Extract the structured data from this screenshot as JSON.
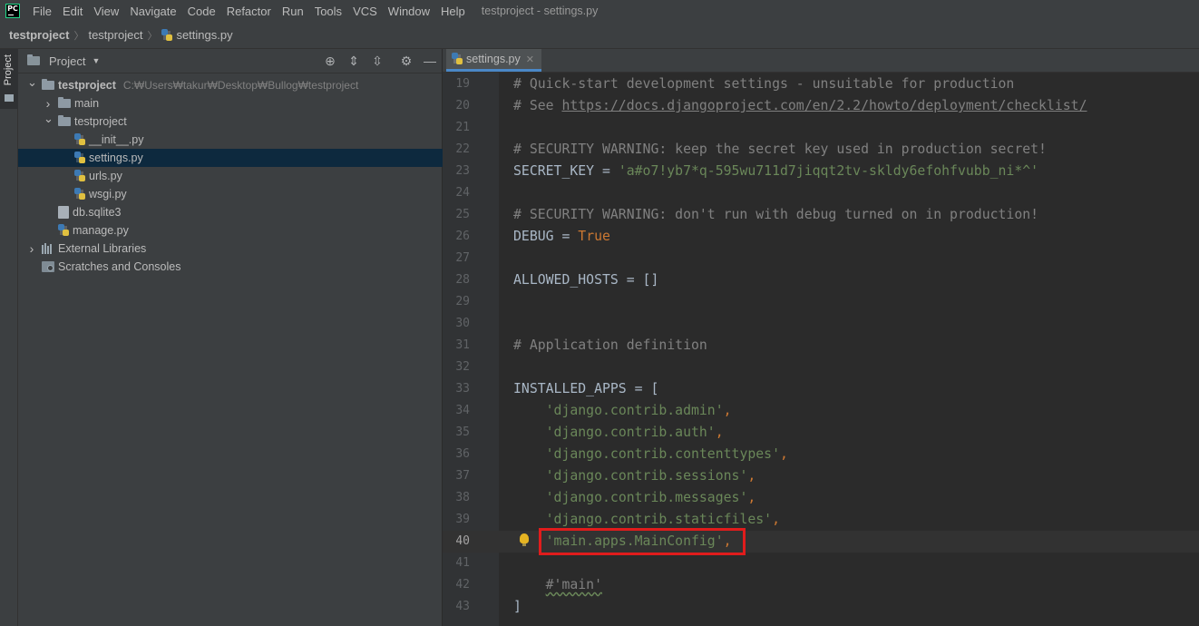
{
  "menubar": {
    "logo": "PC",
    "items": [
      "File",
      "Edit",
      "View",
      "Navigate",
      "Code",
      "Refactor",
      "Run",
      "Tools",
      "VCS",
      "Window",
      "Help"
    ],
    "window_title": "testproject - settings.py"
  },
  "breadcrumbs": [
    "testproject",
    "testproject",
    "settings.py"
  ],
  "left_strip": {
    "tab_label": "Project"
  },
  "project_panel": {
    "title": "Project",
    "tree": [
      {
        "label": "testproject",
        "hint": "C:₩Users₩takur₩Desktop₩Bullog₩testproject",
        "type": "folder",
        "expanded": true
      },
      {
        "label": "main",
        "type": "folder",
        "expanded": false
      },
      {
        "label": "testproject",
        "type": "folder",
        "expanded": true
      },
      {
        "label": "__init__.py",
        "type": "py"
      },
      {
        "label": "settings.py",
        "type": "py",
        "selected": true
      },
      {
        "label": "urls.py",
        "type": "py"
      },
      {
        "label": "wsgi.py",
        "type": "py"
      },
      {
        "label": "db.sqlite3",
        "type": "db"
      },
      {
        "label": "manage.py",
        "type": "py"
      },
      {
        "label": "External Libraries",
        "type": "lib",
        "expanded": false
      },
      {
        "label": "Scratches and Consoles",
        "type": "scratch"
      }
    ]
  },
  "editor": {
    "tab_label": "settings.py",
    "current_line": 40,
    "lines": [
      {
        "n": "19",
        "segs": [
          {
            "t": "# Quick-start development settings - unsuitable for production",
            "c": "comment"
          }
        ]
      },
      {
        "n": "20",
        "segs": [
          {
            "t": "# See ",
            "c": "comment"
          },
          {
            "t": "https://docs.djangoproject.com/en/2.2/howto/deployment/checklist/",
            "c": "link"
          }
        ]
      },
      {
        "n": "21",
        "segs": []
      },
      {
        "n": "22",
        "segs": [
          {
            "t": "# SECURITY WARNING: keep the secret key used in production secret!",
            "c": "comment"
          }
        ]
      },
      {
        "n": "23",
        "segs": [
          {
            "t": "SECRET_KEY = ",
            "c": "plain"
          },
          {
            "t": "'a#o7!yb7*q-595wu711d7jiqqt2tv-skldy6efohfvubb_ni*^'",
            "c": "str"
          }
        ]
      },
      {
        "n": "24",
        "segs": []
      },
      {
        "n": "25",
        "segs": [
          {
            "t": "# SECURITY WARNING: don't run with debug turned on in production!",
            "c": "comment"
          }
        ]
      },
      {
        "n": "26",
        "segs": [
          {
            "t": "DEBUG = ",
            "c": "plain"
          },
          {
            "t": "True",
            "c": "kw"
          }
        ]
      },
      {
        "n": "27",
        "segs": []
      },
      {
        "n": "28",
        "segs": [
          {
            "t": "ALLOWED_HOSTS = []",
            "c": "plain"
          }
        ]
      },
      {
        "n": "29",
        "segs": []
      },
      {
        "n": "30",
        "segs": []
      },
      {
        "n": "31",
        "segs": [
          {
            "t": "# Application definition",
            "c": "comment"
          }
        ]
      },
      {
        "n": "32",
        "segs": []
      },
      {
        "n": "33",
        "segs": [
          {
            "t": "INSTALLED_APPS = [",
            "c": "plain"
          }
        ]
      },
      {
        "n": "34",
        "segs": [
          {
            "t": "    ",
            "c": "plain"
          },
          {
            "t": "'django.contrib.admin'",
            "c": "str"
          },
          {
            "t": ",",
            "c": "kw"
          }
        ]
      },
      {
        "n": "35",
        "segs": [
          {
            "t": "    ",
            "c": "plain"
          },
          {
            "t": "'django.contrib.auth'",
            "c": "str"
          },
          {
            "t": ",",
            "c": "kw"
          }
        ]
      },
      {
        "n": "36",
        "segs": [
          {
            "t": "    ",
            "c": "plain"
          },
          {
            "t": "'django.contrib.contenttypes'",
            "c": "str"
          },
          {
            "t": ",",
            "c": "kw"
          }
        ]
      },
      {
        "n": "37",
        "segs": [
          {
            "t": "    ",
            "c": "plain"
          },
          {
            "t": "'django.contrib.sessions'",
            "c": "str"
          },
          {
            "t": ",",
            "c": "kw"
          }
        ]
      },
      {
        "n": "38",
        "segs": [
          {
            "t": "    ",
            "c": "plain"
          },
          {
            "t": "'django.contrib.messages'",
            "c": "str"
          },
          {
            "t": ",",
            "c": "kw"
          }
        ]
      },
      {
        "n": "39",
        "segs": [
          {
            "t": "    ",
            "c": "plain"
          },
          {
            "t": "'django.contrib.staticfiles'",
            "c": "str"
          },
          {
            "t": ",",
            "c": "kw"
          }
        ]
      },
      {
        "n": "40",
        "segs": [
          {
            "t": "    ",
            "c": "plain"
          },
          {
            "t": "'main.apps.MainConfig'",
            "c": "str"
          },
          {
            "t": ",",
            "c": "kw"
          }
        ]
      },
      {
        "n": "41",
        "segs": []
      },
      {
        "n": "42",
        "segs": [
          {
            "t": "    ",
            "c": "plain"
          },
          {
            "t": "#'main'",
            "c": "comment"
          }
        ]
      },
      {
        "n": "43",
        "segs": [
          {
            "t": "]",
            "c": "plain"
          }
        ]
      }
    ]
  },
  "colors": {
    "highlight_box": "#e01c1c",
    "selection": "#0d293e",
    "tab_underline": "#4a88c7"
  }
}
